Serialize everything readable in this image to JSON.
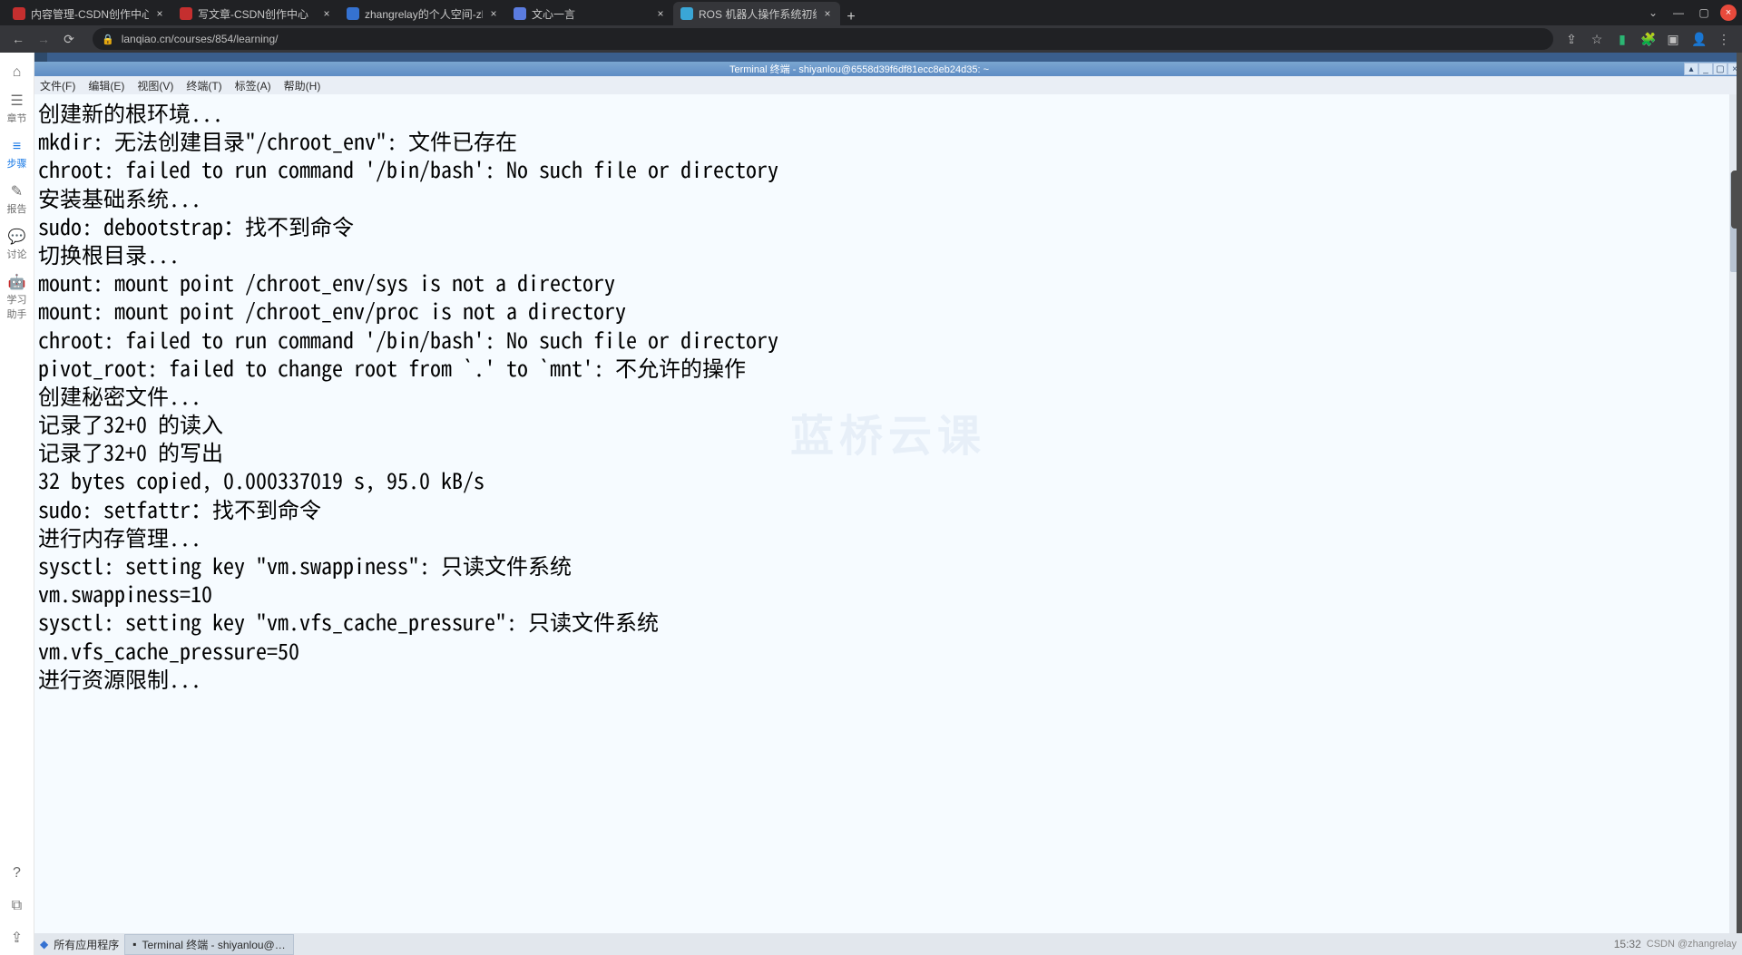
{
  "tabs": [
    {
      "title": "内容管理-CSDN创作中心",
      "favcolor": "#c52f2f",
      "active": false
    },
    {
      "title": "写文章-CSDN创作中心",
      "favcolor": "#c52f2f",
      "active": false
    },
    {
      "title": "zhangrelay的个人空间-zh",
      "favcolor": "#3572d1",
      "active": false
    },
    {
      "title": "文心一言",
      "favcolor": "#5b7ce0",
      "active": false
    },
    {
      "title": "ROS 机器人操作系统初级",
      "favcolor": "#3aa6d6",
      "active": true
    }
  ],
  "toolbar": {
    "url": "lanqiao.cn/courses/854/learning/"
  },
  "leftnav": {
    "items": [
      {
        "icon": "⌂",
        "label": ""
      },
      {
        "icon": "☰",
        "label": "章节"
      },
      {
        "icon": "≡",
        "label": "步骤"
      },
      {
        "icon": "✎",
        "label": "报告"
      },
      {
        "icon": "💬",
        "label": "讨论"
      },
      {
        "icon": "🤖",
        "label": "学习\n助手"
      }
    ],
    "bottom": [
      {
        "icon": "?"
      },
      {
        "icon": "⧉"
      },
      {
        "icon": "⇪"
      }
    ]
  },
  "vm": {
    "title": "Terminal 终端 - shiyanlou@6558d39f6df81ecc8eb24d35: ~",
    "menubar": [
      "文件(F)",
      "编辑(E)",
      "视图(V)",
      "终端(T)",
      "标签(A)",
      "帮助(H)"
    ],
    "taskbar": {
      "apps_label": "所有应用程序",
      "term_label": "Terminal 终端 - shiyanlou@…",
      "credit": "CSDN @zhangrelay",
      "clock": "15:32"
    },
    "watermark": "蓝桥云课"
  },
  "terminal_lines": [
    "创建新的根环境...",
    "mkdir: 无法创建目录\"/chroot_env\": 文件已存在",
    "chroot: failed to run command '/bin/bash': No such file or directory",
    "安装基础系统...",
    "sudo: debootstrap：找不到命令",
    "切换根目录...",
    "mount: mount point /chroot_env/sys is not a directory",
    "mount: mount point /chroot_env/proc is not a directory",
    "chroot: failed to run command '/bin/bash': No such file or directory",
    "pivot_root: failed to change root from `.' to `mnt': 不允许的操作",
    "创建秘密文件...",
    "记录了32+0 的读入",
    "记录了32+0 的写出",
    "32 bytes copied, 0.000337019 s, 95.0 kB/s",
    "sudo: setfattr：找不到命令",
    "进行内存管理...",
    "sysctl: setting key \"vm.swappiness\": 只读文件系统",
    "vm.swappiness=10",
    "sysctl: setting key \"vm.vfs_cache_pressure\": 只读文件系统",
    "vm.vfs_cache_pressure=50",
    "进行资源限制..."
  ]
}
